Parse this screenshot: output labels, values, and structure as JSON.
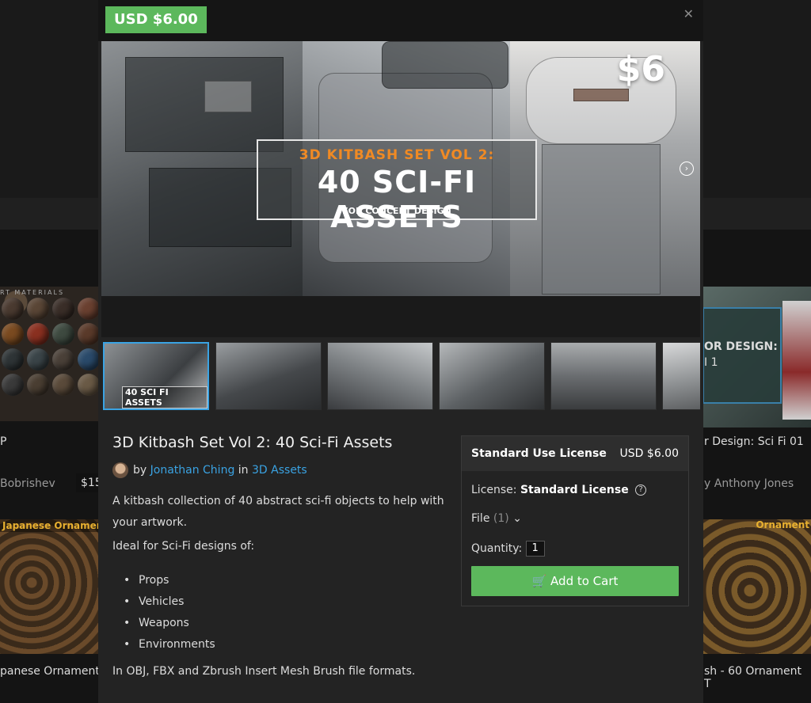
{
  "background": {
    "left": {
      "section_label": "RT MATERIALS",
      "title": "P",
      "author": "Bobrishev",
      "price": "$15",
      "ornament_label": "Japanese Ornament",
      "ornament_title": "panese Ornament"
    },
    "right": {
      "panel_line1": "OR DESIGN:",
      "panel_line2": "I 1",
      "title": "r Design: Sci Fi 01",
      "author": "y Anthony Jones",
      "ornament_label": "Ornament",
      "ornament_title": "sh - 60 Ornament T"
    }
  },
  "modal": {
    "close_icon": "close-icon",
    "price_badge": "USD $6.00",
    "hero": {
      "price": "$6",
      "subtitle": "3D KITBASH SET VOL 2:",
      "headline": "40 SCI-FI ASSETS",
      "tagline": "FOR CONCEPT DESIGN",
      "next_icon": "chevron-right-circle-icon"
    },
    "thumbnails": [
      {
        "label": "40 SCI FI ASSETS",
        "active": true
      },
      {
        "label": "",
        "active": false
      },
      {
        "label": "",
        "active": false
      },
      {
        "label": "",
        "active": false
      },
      {
        "label": "",
        "active": false
      },
      {
        "label": "",
        "active": false
      }
    ],
    "product": {
      "title": "3D Kitbash Set Vol 2: 40 Sci-Fi Assets",
      "by": "by",
      "author": "Jonathan Ching",
      "in": "in",
      "category": "3D Assets",
      "description": "A kitbash collection of 40 abstract sci-fi objects to help with your artwork.",
      "ideal_for": "Ideal for Sci-Fi designs of:",
      "uses": [
        "Props",
        "Vehicles",
        "Weapons",
        "Environments"
      ],
      "formats": "In OBJ, FBX and Zbrush Insert Mesh Brush file formats."
    },
    "purchase": {
      "license_name": "Standard Use License",
      "license_price": "USD $6.00",
      "license_label": "License:",
      "license_value": "Standard License",
      "file_label": "File",
      "file_count": "(1)",
      "quantity_label": "Quantity:",
      "quantity_value": "1",
      "add_to_cart": "Add to Cart",
      "cart_icon": "cart-icon"
    }
  },
  "colors": {
    "accent_green": "#5cb85c",
    "link_blue": "#3aa3e3",
    "hero_orange": "#f08a24",
    "ornament_gold": "#e8b030"
  }
}
